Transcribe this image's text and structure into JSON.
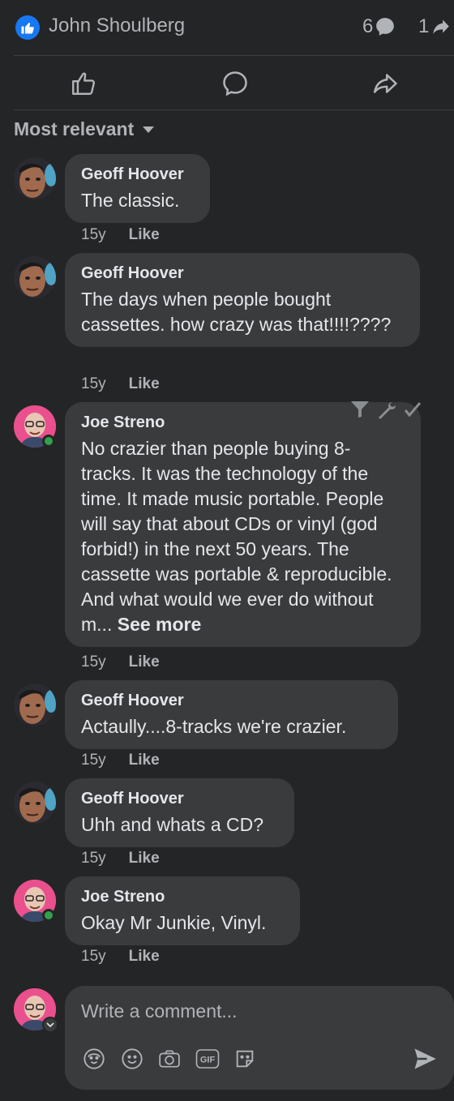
{
  "header": {
    "reactor_name": "John Shoulberg",
    "comment_count": "6",
    "share_count": "1",
    "like_badge_icon": "thumbs-up-icon",
    "accent_color": "#1877f2"
  },
  "actions": {
    "like_icon": "thumbs-up-outline-icon",
    "comment_icon": "comment-bubble-icon",
    "share_icon": "share-arrow-icon"
  },
  "sort": {
    "label": "Most relevant"
  },
  "comments": [
    {
      "author": "Geoff Hoover",
      "text": "The classic.",
      "age": "15y",
      "like_label": "Like"
    },
    {
      "author": "Geoff Hoover",
      "text": "The days when people bought cassettes. how crazy was that!!!!????",
      "age": "15y",
      "like_label": "Like"
    },
    {
      "author": "Joe Streno",
      "text": "No crazier than people buying 8-tracks. It was the technology of the time. It made music portable. People will say that about CDs or vinyl (god forbid!) in the next 50 years. The cassette was portable & reproducible. And what would we ever do without m...",
      "see_more": "See more",
      "age": "15y",
      "like_label": "Like"
    },
    {
      "author": "Geoff Hoover",
      "text": "Actaully....8-tracks we're crazier.",
      "age": "15y",
      "like_label": "Like"
    },
    {
      "author": "Geoff Hoover",
      "text": "Uhh and whats a CD?",
      "age": "15y",
      "like_label": "Like"
    },
    {
      "author": "Joe Streno",
      "text": "Okay Mr Junkie, Vinyl.",
      "age": "15y",
      "like_label": "Like"
    }
  ],
  "composer": {
    "placeholder": "Write a comment...",
    "tools": [
      "avatar-sticker-icon",
      "emoji-icon",
      "camera-icon",
      "gif-icon",
      "sticker-icon"
    ],
    "gif_label": "GIF",
    "send_icon": "send-icon"
  }
}
